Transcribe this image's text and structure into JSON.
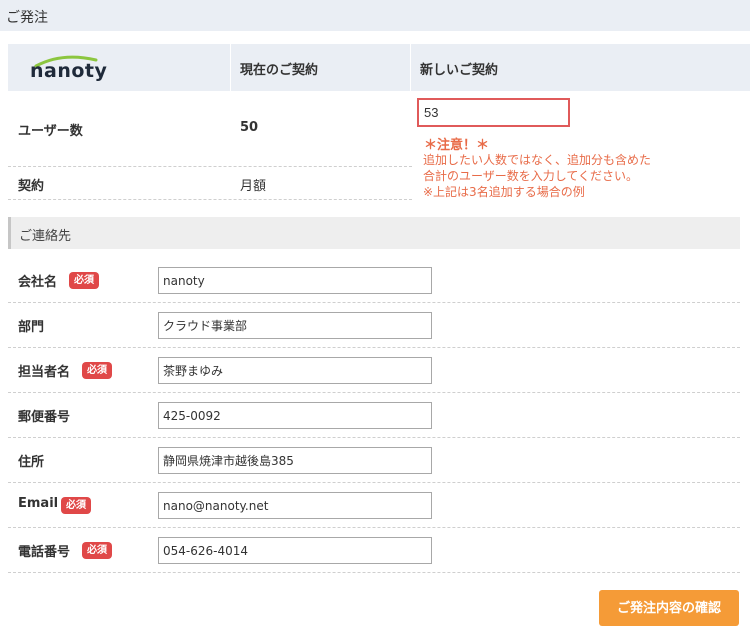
{
  "page": {
    "title": "ご発注"
  },
  "contract": {
    "logo_text": "nanoty",
    "headers": {
      "current": "現在のご契約",
      "new": "新しいご契約"
    },
    "users": {
      "label": "ユーザー数",
      "current": "50",
      "new_value": "53"
    },
    "plan": {
      "label": "契約",
      "current": "月額"
    },
    "notice": {
      "title": "＊注意！＊",
      "lines": [
        "追加したい人数ではなく、追加分も含めた",
        "合計のユーザー数を入力してください。",
        "※上記は3名追加する場合の例"
      ]
    }
  },
  "contact": {
    "section_title": "ご連絡先",
    "required_label": "必須",
    "fields": [
      {
        "label": "会社名",
        "value": "nanoty",
        "required": true
      },
      {
        "label": "部門",
        "value": "クラウド事業部",
        "required": false
      },
      {
        "label": "担当者名",
        "value": "茶野まゆみ",
        "required": true
      },
      {
        "label": "郵便番号",
        "value": "425-0092",
        "required": false
      },
      {
        "label": "住所",
        "value": "静岡県焼津市越後島385",
        "required": false
      },
      {
        "label": "Email",
        "value": "nano@nanoty.net",
        "required": true
      },
      {
        "label": "電話番号",
        "value": "054-626-4014",
        "required": true
      }
    ]
  },
  "actions": {
    "confirm_label": "ご発注内容の確認"
  },
  "colors": {
    "accent": "#f59b37",
    "required": "#e04848",
    "notice": "#e86b48",
    "highlight_border": "#e05a5a"
  }
}
